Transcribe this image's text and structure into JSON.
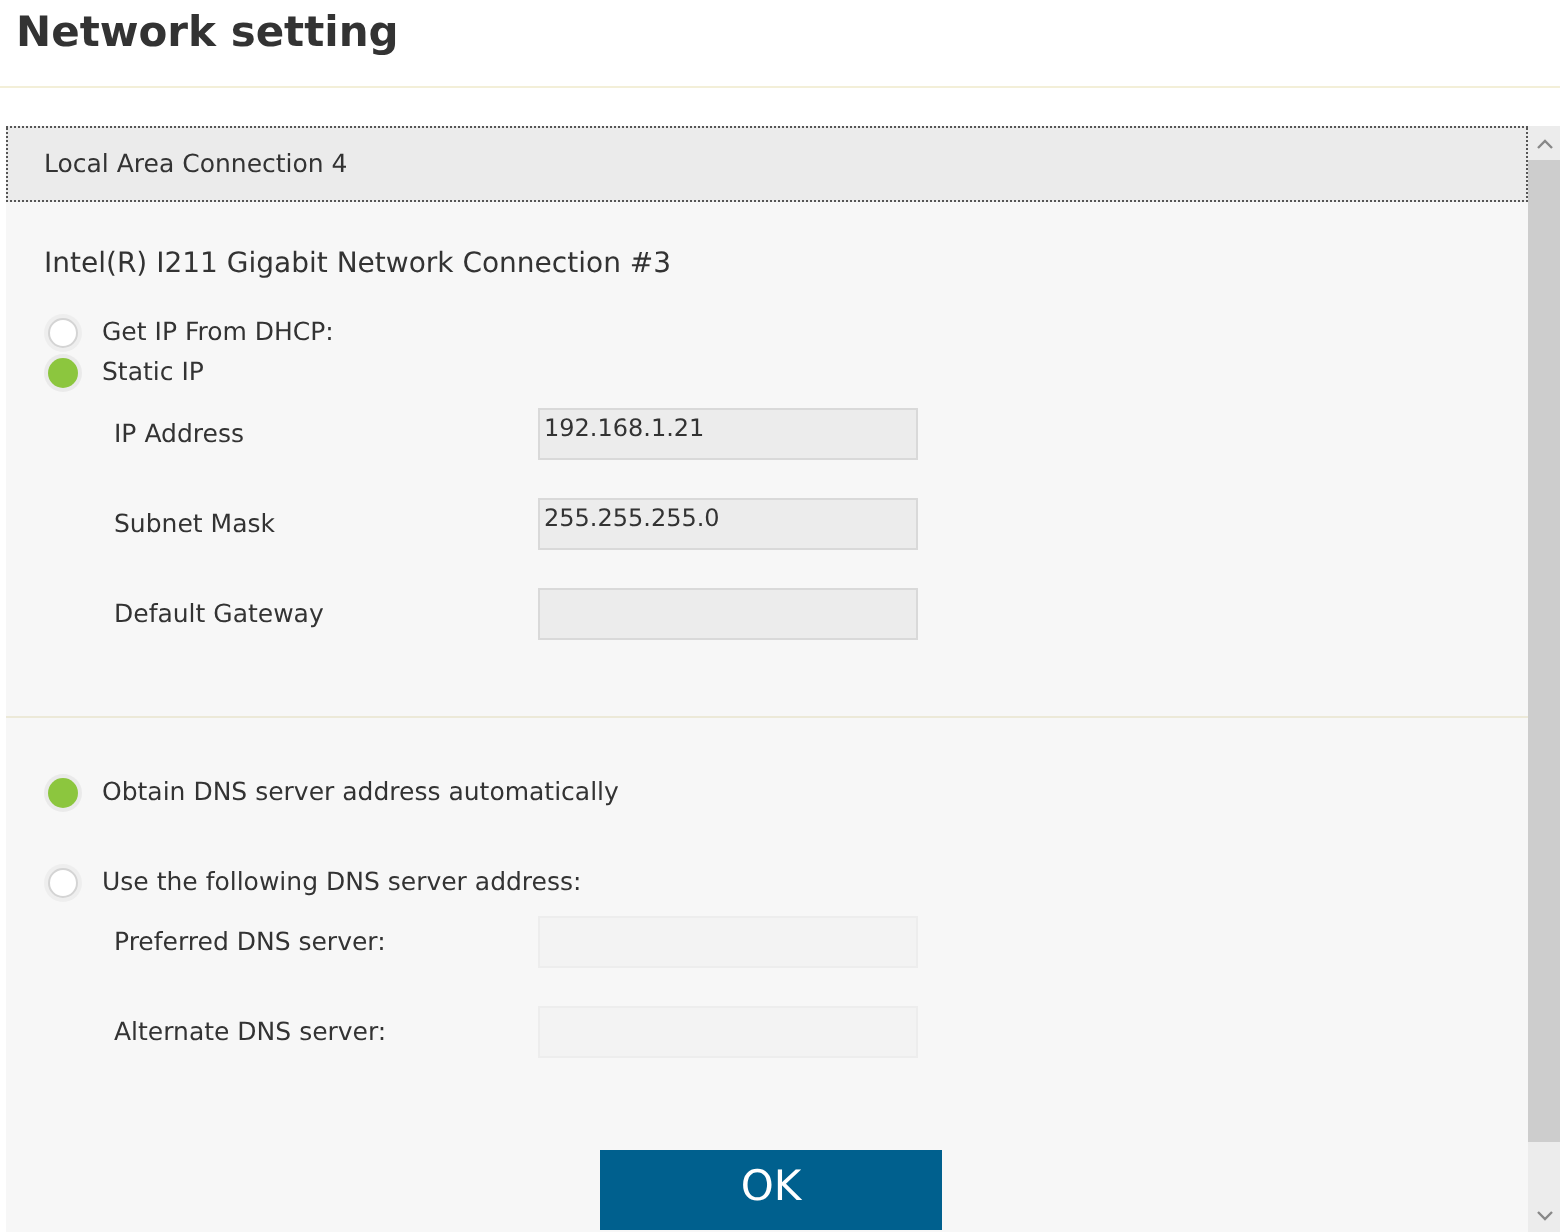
{
  "title": "Network setting",
  "connection": {
    "label": "Local Area Connection 4",
    "adapter": "Intel(R) I211 Gigabit Network Connection #3"
  },
  "ip_options": [
    {
      "label": "Get IP From DHCP:",
      "selected": false
    },
    {
      "label": "Static IP",
      "selected": true
    }
  ],
  "ip_fields": [
    {
      "label": "IP Address",
      "value": "192.168.1.21",
      "disabled": false
    },
    {
      "label": "Subnet Mask",
      "value": "255.255.255.0",
      "disabled": false
    },
    {
      "label": "Default Gateway",
      "disabled": false
    }
  ],
  "dns_options": [
    {
      "label": "Obtain DNS server address automatically",
      "selected": true
    },
    {
      "label": "Use the following DNS server address:",
      "selected": false
    }
  ],
  "dns_fields": [
    {
      "label": "Preferred DNS server:",
      "disabled": true
    },
    {
      "label": "Alternate DNS server:",
      "disabled": true
    }
  ],
  "ok_button": "OK"
}
